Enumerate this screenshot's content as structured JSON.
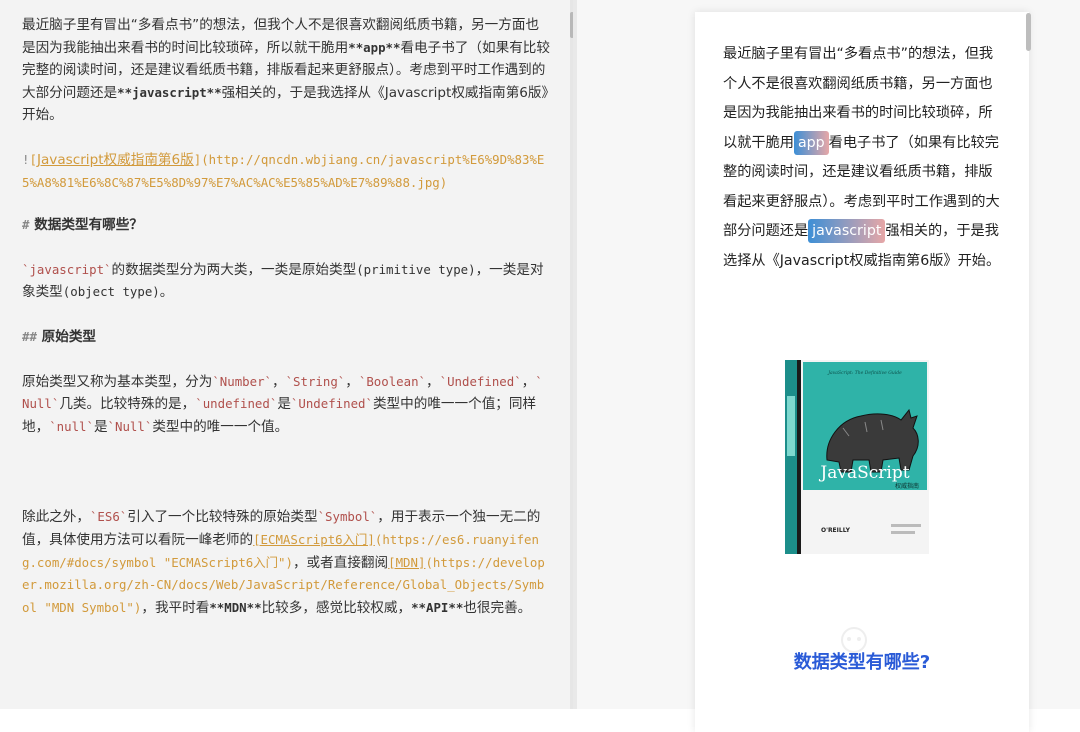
{
  "editor": {
    "p1": {
      "a": "最近脑子里有冒出“多看点书”的想法，但我个人不是很喜欢翻阅纸质书籍，另一方面也是因为我能抽出来看书的时间比较琐碎，所以就干脆用",
      "b1": "**app**",
      "c": "看电子书了（如果有比较完整的阅读时间，还是建议看纸质书籍，排版看起来更舒服点）。考虑到平时工作遇到的大部分问题还是",
      "b2": "**javascript**",
      "d": "强相关的，于是我选择从",
      "e": "《Javascript权威指南第6版》开始。"
    },
    "img_line": {
      "bang": "!",
      "open": "[",
      "link": "Javascript权威指南第6版",
      "close": "]",
      "url": "(http://qncdn.wbjiang.cn/javascript%E6%9D%83%E5%A8%81%E6%8C%87%E5%8D%97%E7%AC%AC%E5%85%AD%E7%89%88.jpg)"
    },
    "h1": {
      "mark": "#",
      "text": "数据类型有哪些？"
    },
    "p2": {
      "code": "`javascript`",
      "a": "的数据类型分为两大类，一类是原始类型",
      "m1": "(primitive type)",
      "b": "，一类是对象类型",
      "m2": "(object type)",
      "c": "。"
    },
    "h2": {
      "mark": "##",
      "text": "原始类型"
    },
    "p3": {
      "a": "原始类型又称为基本类型，分为",
      "c1": "`Number`",
      "s1": "，",
      "c2": "`String`",
      "s2": "，",
      "c3": "`Boolean`",
      "s3": "，",
      "c4": "`Undefined`",
      "s4": "，",
      "c5": "`Null`",
      "b": "几类。比较特殊的是，",
      "c6": "`undefined`",
      "c": "是",
      "c7": "`Undefined`",
      "d": "类型中的唯一一个值；同样地，",
      "c8": "`null`",
      "e": "是",
      "c9": "`Null`",
      "f": "类型中的唯一一个值。"
    },
    "p4": {
      "a": "除此之外，",
      "c1": "`ES6`",
      "b": "引入了一个比较特殊的原始类型",
      "c2": "`Symbol`",
      "c": "，用于表示一个独一无二的值，具体使用方法可以看阮一峰老师的",
      "l1": "[ECMAScript6入门]",
      "u1": "(https://es6.ruanyifeng.com/#docs/symbol \"ECMAScript6入门\")",
      "d": "，或者直接翻阅",
      "l2": "[MDN]",
      "u2": "(https://developer.mozilla.org/zh-CN/docs/Web/JavaScript/Reference/Global_Objects/Symbol \"MDN Symbol\")",
      "e": "，我平时看",
      "b1": "**MDN**",
      "f": "比较多，感觉比较权威，",
      "b2": "**API**",
      "g": "也很完善。"
    }
  },
  "preview": {
    "p1": {
      "a": "最近脑子里有冒出“多看点书”的想法，但我个人不是很喜欢翻阅纸质书籍，另一方面也是因为我能抽出来看书的时间比较琐碎，所以就干脆用",
      "chip1": "app",
      "b": "看电子书了（如果有比较完整的阅读时间，还是建议看纸质书籍，排版看起来更舒服点）。考虑到平时工作遇到的大部分问题还是",
      "chip2": "javascript",
      "c": "强相关的，于是我选择从《Javascript权威指南第6版》开始。"
    },
    "book": {
      "title_cn": "权威指南",
      "title_en": "JavaScript",
      "subtitle": "JavaScript: The Definitive Guide",
      "publisher": "O'REILLY"
    },
    "heading": "数据类型有哪些?"
  },
  "colors": {
    "code": "#b0504c",
    "link": "#d29a3b",
    "heading_blue": "#2a5bd7",
    "chip_start": "#3d8fd6",
    "chip_end": "#e7a7a7"
  }
}
